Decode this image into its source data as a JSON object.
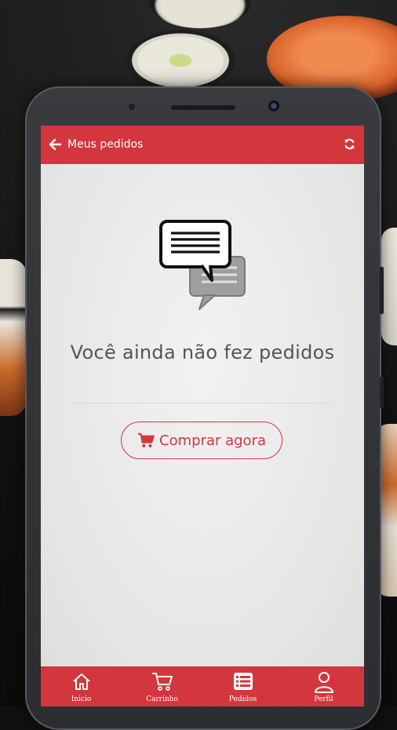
{
  "header": {
    "title": "Meus pedidos",
    "back_icon": "arrow-left-icon",
    "refresh_icon": "refresh-icon"
  },
  "empty_state": {
    "icon": "chat-bubbles-icon",
    "message": "Você ainda não fez pedidos",
    "button_label": "Comprar agora",
    "button_icon": "cart-icon"
  },
  "bottom_nav": {
    "items": [
      {
        "label": "Inicio",
        "icon": "home-icon"
      },
      {
        "label": "Carrinho",
        "icon": "cart-icon"
      },
      {
        "label": "Pedidos",
        "icon": "list-icon"
      },
      {
        "label": "Perfil",
        "icon": "user-icon"
      }
    ]
  },
  "colors": {
    "primary": "#d3363d",
    "background": "#ebebeb",
    "text": "#555555"
  }
}
